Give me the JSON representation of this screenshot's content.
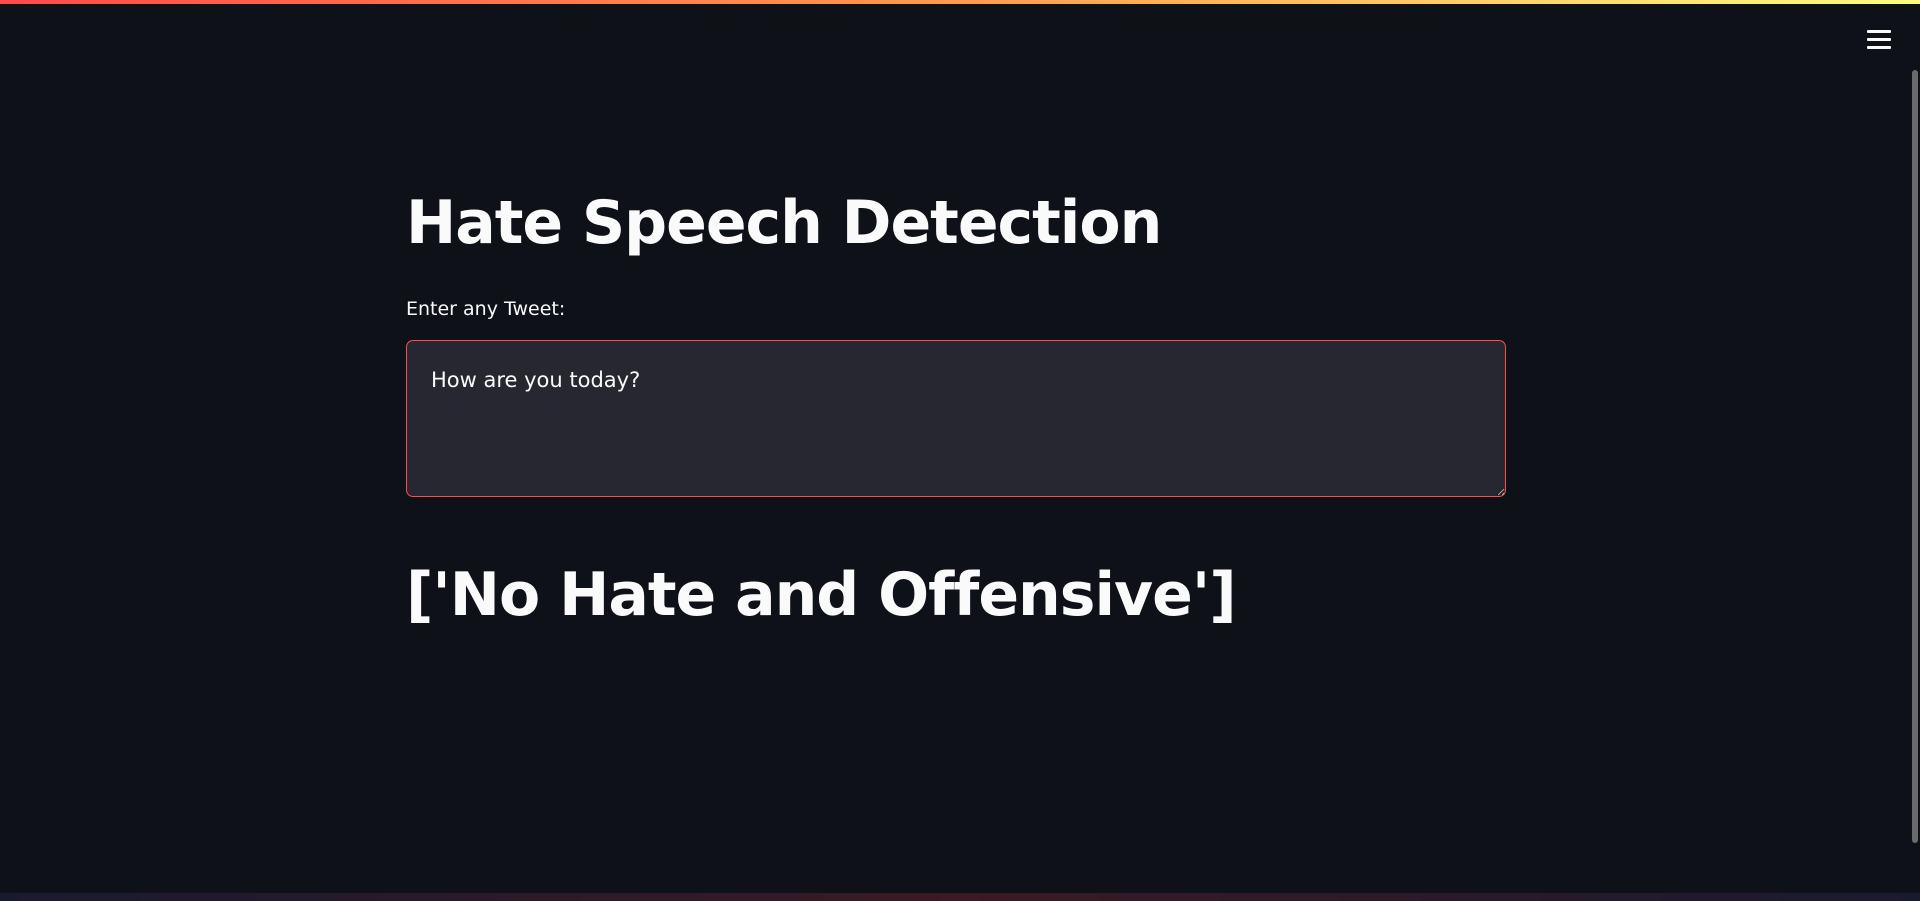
{
  "app": {
    "title": "Hate Speech Detection"
  },
  "form": {
    "label": "Enter any Tweet:",
    "tweet_value": "How are you today?"
  },
  "result": {
    "prediction": "['No Hate and Offensive']"
  },
  "header": {
    "menu_icon": "hamburger-menu-icon"
  },
  "colors": {
    "background": "#0e1117",
    "input_background": "#262730",
    "accent": "#ff4b4b",
    "text": "#fafafa"
  }
}
